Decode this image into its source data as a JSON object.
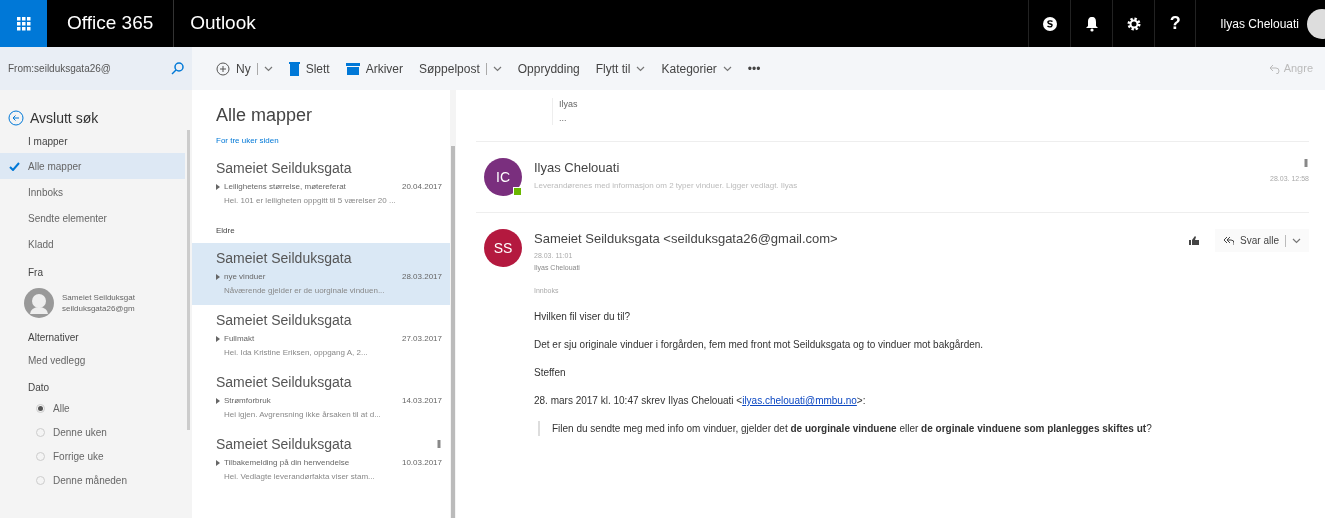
{
  "topbar": {
    "suite": "Office 365",
    "app": "Outlook",
    "help": "?",
    "user": "Ilyas Chelouati"
  },
  "search": {
    "value": "From:seilduksgata26@"
  },
  "toolbar": {
    "items": [
      {
        "kind": "new",
        "label": "Ny"
      },
      {
        "kind": "delete",
        "label": "Slett"
      },
      {
        "kind": "archive",
        "label": "Arkiver"
      },
      {
        "kind": "split",
        "label": "Søppelpost"
      },
      {
        "kind": "plain",
        "label": "Opprydding"
      },
      {
        "kind": "menu",
        "label": "Flytt til"
      },
      {
        "kind": "menu",
        "label": "Kategorier"
      },
      {
        "kind": "more",
        "label": "•••"
      }
    ],
    "undo": {
      "label": "Angre",
      "disabled": true
    }
  },
  "sidebar": {
    "exit": "Avslutt søk",
    "folders_header": "I mapper",
    "folders": [
      {
        "label": "Alle mapper",
        "selected": true
      },
      {
        "label": "Innboks",
        "selected": false
      },
      {
        "label": "Sendte elementer",
        "selected": false
      },
      {
        "label": "Kladd",
        "selected": false
      }
    ],
    "from_header": "Fra",
    "from": {
      "name": "Sameiet Seilduksgat",
      "email": "seilduksgata26@gm"
    },
    "options_header": "Alternativer",
    "options": [
      "Med vedlegg"
    ],
    "date_header": "Dato",
    "dates": [
      {
        "label": "Alle",
        "selected": true
      },
      {
        "label": "Denne uken",
        "selected": false
      },
      {
        "label": "Forrige uke",
        "selected": false
      },
      {
        "label": "Denne måneden",
        "selected": false
      }
    ]
  },
  "list": {
    "title": "Alle mapper",
    "groups": [
      {
        "header": "For tre uker siden",
        "messages": [
          {
            "sender": "Sameiet Seilduksgata",
            "subject": "Leilighetens størrelse, møtereferat",
            "date": "20.04.2017",
            "preview": "Hei. 101 er leiligheten oppgitt til 5 værelser 20 ...",
            "selected": false,
            "attachment": false
          }
        ]
      },
      {
        "header": "Eldre",
        "messages": [
          {
            "sender": "Sameiet Seilduksgata",
            "subject": "nye vinduer",
            "date": "28.03.2017",
            "preview": "Nåværende gjelder er de uorginale vinduen...",
            "selected": true,
            "attachment": false
          },
          {
            "sender": "Sameiet Seilduksgata",
            "subject": "Fullmakt",
            "date": "27.03.2017",
            "preview": "Hei. Ida Kristine Eriksen, oppgang A, 2...",
            "selected": false,
            "attachment": false
          },
          {
            "sender": "Sameiet Seilduksgata",
            "subject": "Strømforbruk",
            "date": "14.03.2017",
            "preview": "Hei igjen. Avgrensning ikke årsaken til at d...",
            "selected": false,
            "attachment": false
          },
          {
            "sender": "Sameiet Seilduksgata",
            "subject": "Tilbakemelding på din henvendelse",
            "date": "10.03.2017",
            "preview": "Hei. Vedlagte leverandørfakta viser stam...",
            "selected": false,
            "attachment": true
          }
        ]
      }
    ]
  },
  "reading": {
    "collapsed": {
      "name": "Ilyas",
      "more": "..."
    },
    "messages": [
      {
        "initials": "IC",
        "color": "#7a2f7e",
        "sender": "Ilyas Chelouati",
        "preview": "Leverandørenes med informasjon om 2 typer vinduer. Ligger vedlagt. Ilyas",
        "date": "28.03. 12:58",
        "attachment": true,
        "online": true
      },
      {
        "initials": "SS",
        "color": "#b4193f",
        "sender": "Sameiet Seilduksgata <seilduksgata26@gmail.com>",
        "date": "28.03. 11:01",
        "to": "Ilyas Chelouati",
        "reply": "Svar alle",
        "folder": "Innboks",
        "body": [
          "Hvilken fil viser du til?",
          "Det er sju originale vinduer i forgården, fem med front mot Seilduksgata og to vinduer mot bakgården.",
          "Steffen"
        ],
        "quote_intro": "28. mars 2017 kl. 10:47 skrev Ilyas Chelouati <",
        "quote_link": "ilyas.chelouati@mmbu.no",
        "quote_end": ">:",
        "quote": "Filen du sendte meg med info om vinduer, gjelder det **de uorginale vinduene** eller **de orginale vinduene som planlegges skiftes ut**?"
      }
    ]
  }
}
